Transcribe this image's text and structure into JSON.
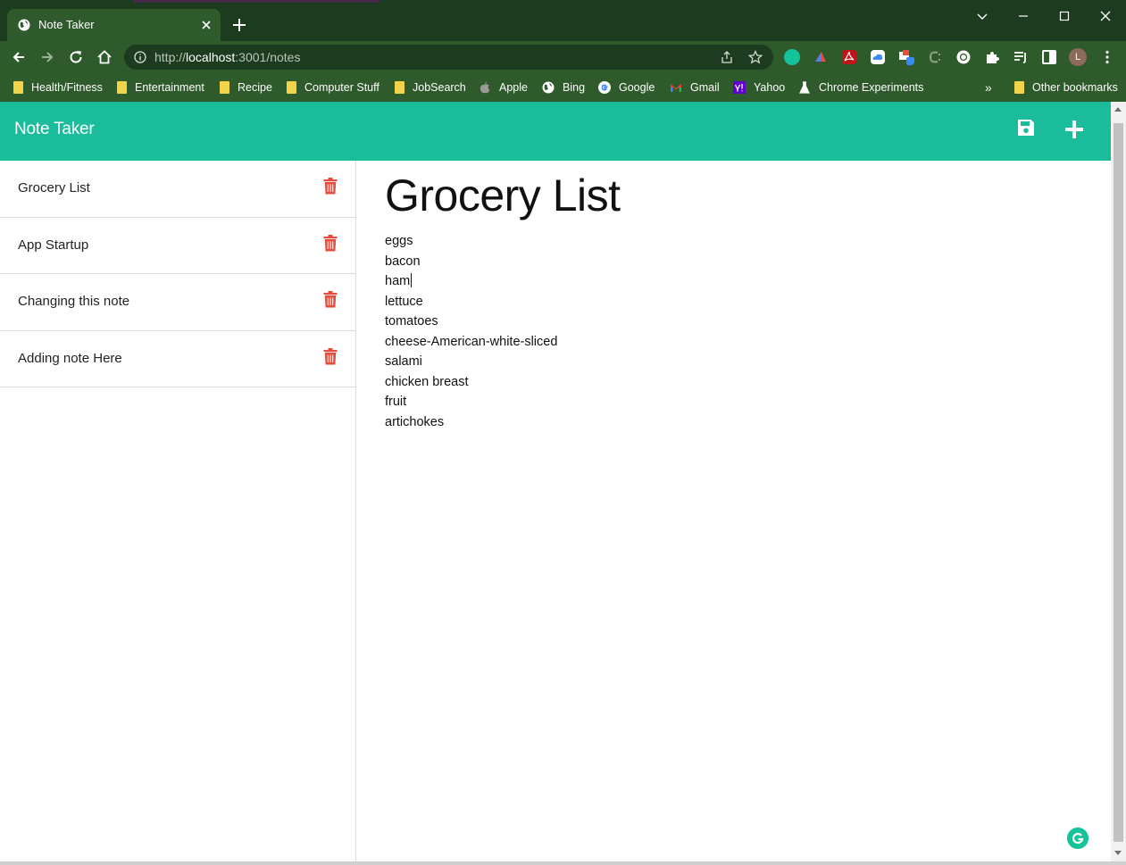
{
  "browser": {
    "tab_title": "Note Taker",
    "url_prefix": "http://",
    "url_host": "localhost",
    "url_rest": ":3001/notes",
    "profile_initial": "L",
    "bookmarks": [
      {
        "label": "Health/Fitness",
        "icon": "folder-icon"
      },
      {
        "label": "Entertainment",
        "icon": "folder-icon"
      },
      {
        "label": "Recipe",
        "icon": "folder-icon"
      },
      {
        "label": "Computer Stuff",
        "icon": "folder-icon"
      },
      {
        "label": "JobSearch",
        "icon": "folder-icon"
      },
      {
        "label": "Apple",
        "icon": "apple-icon"
      },
      {
        "label": "Bing",
        "icon": "globe-icon"
      },
      {
        "label": "Google",
        "icon": "google-icon"
      },
      {
        "label": "Gmail",
        "icon": "gmail-icon"
      },
      {
        "label": "Yahoo",
        "icon": "yahoo-icon"
      },
      {
        "label": "Chrome Experiments",
        "icon": "flask-icon"
      }
    ],
    "bookmarks_overflow": "»",
    "other_bookmarks": "Other bookmarks"
  },
  "app": {
    "brand": "Note Taker",
    "accent_color": "#1abc9c",
    "delete_color": "#e74c3c"
  },
  "notes": [
    {
      "title": "Grocery List"
    },
    {
      "title": "App Startup"
    },
    {
      "title": "Changing this note"
    },
    {
      "title": "Adding note Here"
    }
  ],
  "active_note": {
    "title": "Grocery List",
    "lines": [
      "eggs",
      "bacon",
      "ham",
      "lettuce",
      "tomatoes",
      "cheese-American-white-sliced",
      "salami",
      "chicken breast",
      "fruit",
      "artichokes"
    ]
  }
}
